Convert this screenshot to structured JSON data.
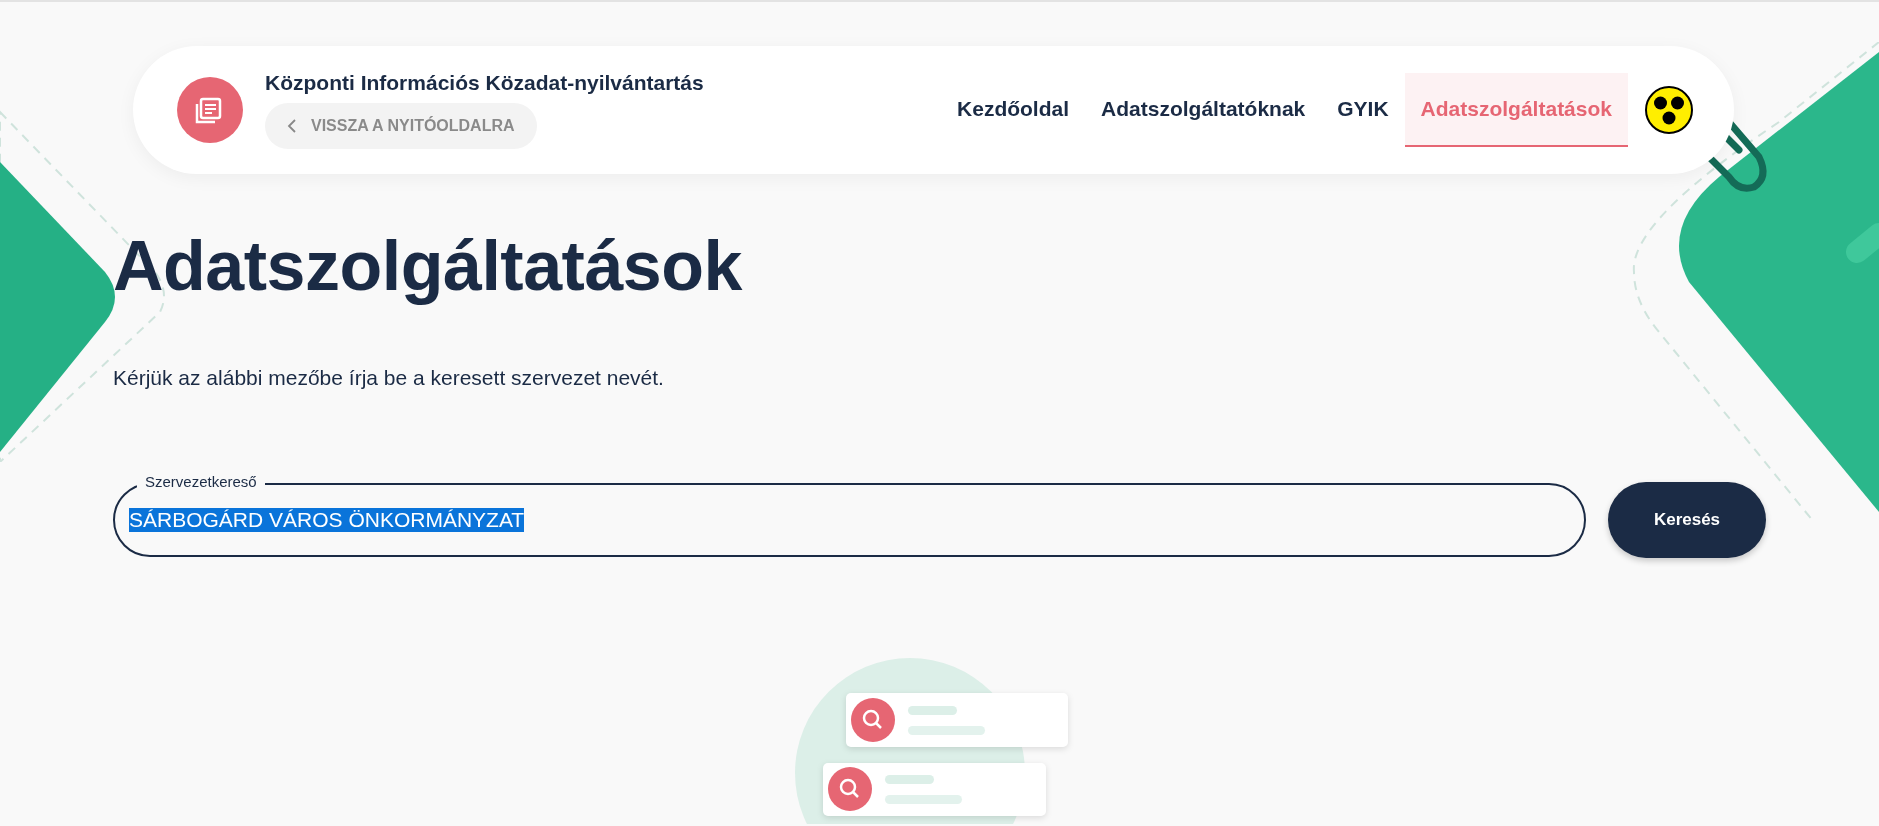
{
  "header": {
    "site_title": "Központi Információs Közadat-nyilvántartás",
    "back_link": "VISSZA A NYITÓOLDALRA",
    "nav": [
      {
        "label": "Kezdőoldal",
        "selected": false
      },
      {
        "label": "Adatszolgáltatóknak",
        "selected": false
      },
      {
        "label": "GYIK",
        "selected": false
      },
      {
        "label": "Adatszolgáltatások",
        "selected": true
      }
    ]
  },
  "page": {
    "title": "Adatszolgáltatások",
    "intro": "Kérjük az alábbi mezőbe írja be a keresett szervezet nevét."
  },
  "search": {
    "label": "Szervezetkereső",
    "value": "SÁRBOGÁRD VÁROS ÖNKORMÁNYZAT",
    "value_selected": true,
    "button": "Keresés"
  }
}
